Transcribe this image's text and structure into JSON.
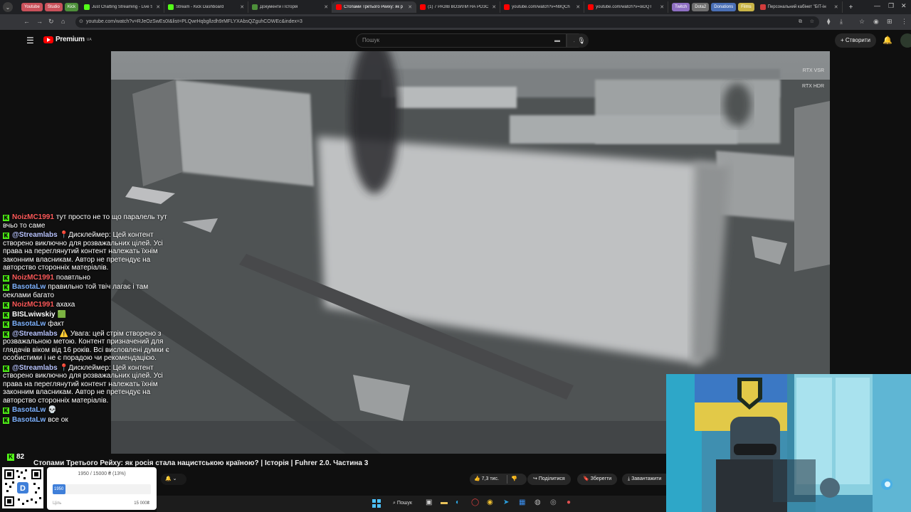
{
  "browser": {
    "menu_glyph": "⌄",
    "pinned": [
      {
        "label": "Youtube",
        "color": "#c9515a"
      },
      {
        "label": "Studio",
        "color": "#c9515a"
      },
      {
        "label": "Kick",
        "color": "#4d8f3a"
      }
    ],
    "tabs": [
      {
        "title": "Just Chatting Streaming - Live S",
        "favicon": "#53fc18"
      },
      {
        "title": "Stream - Kick Dashboard",
        "favicon": "#53fc18"
      },
      {
        "title": "Документи і Історія",
        "favicon": "#4d8f3a"
      },
      {
        "title": "Стопами Третього Рейху: як р",
        "favicon": "#ff0000",
        "active": true
      },
      {
        "title": "(1) 7 РАЗІВ ВОЗИЛИ НА РОЗС",
        "favicon": "#ff0000"
      },
      {
        "title": "youtube.com/watch?v=N9QCh",
        "favicon": "#ff0000"
      },
      {
        "title": "youtube.com/watch?v=oiDQT",
        "favicon": "#ff0000"
      }
    ],
    "group_pills": [
      {
        "label": "Twitch",
        "color": "#8e6fc2"
      },
      {
        "label": "Dota2",
        "color": "#6f6f6f"
      },
      {
        "label": "Donations",
        "color": "#4a6fb5"
      },
      {
        "label": "Films",
        "color": "#c9b447"
      }
    ],
    "last_tab": "Персональний кабінет \"БІТ-ін",
    "new_tab": "+",
    "url": "youtube.com/watch?v=RJeOzSwEs0I&list=PLQwrHqbgllzdh9rMFLYXAbsQZguhCOWEc&index=3"
  },
  "youtube": {
    "logo": "Premium",
    "region": "UA",
    "search_placeholder": "Пошук",
    "create_label": "+ Створити",
    "video_title": "Стопами Третього Рейху: як росія стала нацистською країною? | Історія | Fuhrer 2.0. Частина 3",
    "like_count": "7,3 тис.",
    "share_label": "Поділитися",
    "save_label": "Зберегти",
    "download_label": "Завантажити",
    "rtx_vsr": "RTX VSR",
    "rtx_hdr": "RTX HDR"
  },
  "chat": {
    "messages": [
      {
        "user": "NoizMC1991",
        "color": "#ff5a5a",
        "text": "тут просто не то що паралель тут вчьо то саме"
      },
      {
        "user": "@Streamlabs",
        "color": "#b9c4ff",
        "text": "📍Дисклеймер: Цей контент створено виключно для розважальних цілей. Усі права на переглянутий контент належать їхнім законним власникам. Автор не претендує на авторство сторонніх матеріалів."
      },
      {
        "user": "NoizMC1991",
        "color": "#ff5a5a",
        "text": "поавтльно"
      },
      {
        "user": "BasotaLw",
        "color": "#7fb3ff",
        "text": "правильно той твіч лагає і там оеклами багато"
      },
      {
        "user": "NoizMC1991",
        "color": "#ff5a5a",
        "text": "ахаха"
      },
      {
        "user": "BISLwiwskiy",
        "color": "#ffffff",
        "text": "🟩"
      },
      {
        "user": "BasotaLw",
        "color": "#7fb3ff",
        "text": "факт"
      },
      {
        "user": "@Streamlabs",
        "color": "#b9c4ff",
        "text": "⚠️ Увага: цей стрім створено з розважальною метою. Контент призначений для глядачів віком від 16 років. Всі висловлені думки є особистими і не є порадою чи рекомендацією."
      },
      {
        "user": "@Streamlabs",
        "color": "#b9c4ff",
        "text": "📍Дисклеймер: Цей контент створено виключно для розважальних цілей. Усі права на переглянутий контент належать їхнім законним власникам. Автор не претендує на авторство сторонніх матеріалів."
      },
      {
        "user": "BasotaLw",
        "color": "#7fb3ff",
        "text": "💀"
      },
      {
        "user": "BasotaLw",
        "color": "#7fb3ff",
        "text": "все ок"
      }
    ]
  },
  "stream": {
    "viewers": "82",
    "goal_text": "1950 / 15000 ₴ (13%)",
    "goal_current": "1950",
    "goal_label": "Ціль",
    "goal_target": "15 000₴",
    "goal_progress": 0.13
  },
  "taskbar": {
    "search_label": "Пошук"
  },
  "colors": {
    "kick_green": "#53fc18",
    "yt_red": "#ff0000",
    "goal_blue": "#3f7fd9"
  }
}
